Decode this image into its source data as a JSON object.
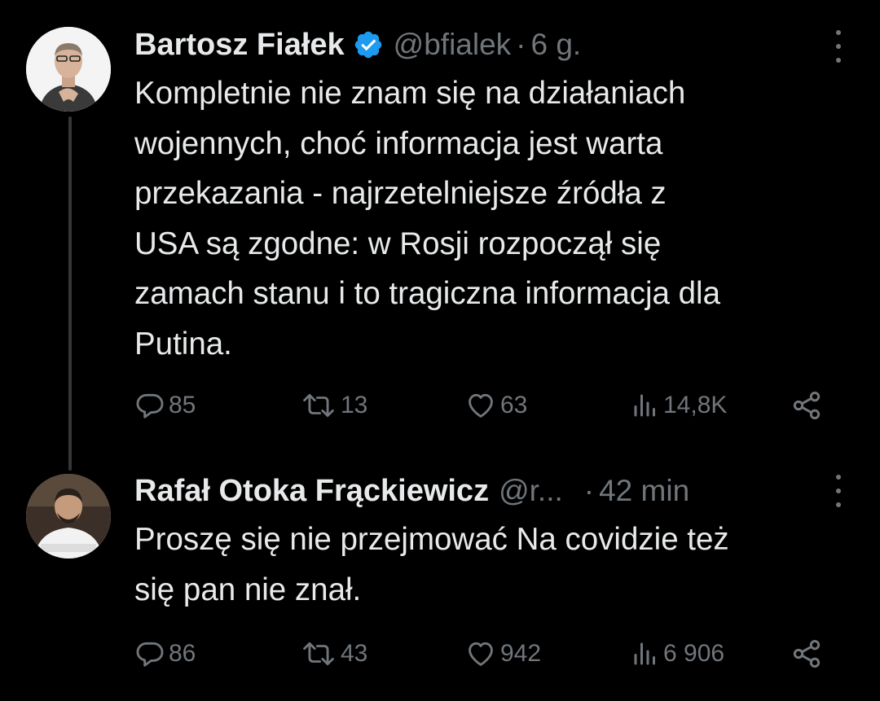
{
  "tweets": [
    {
      "author_name": "Bartosz Fiałek",
      "verified": true,
      "handle": "@bfialek",
      "separator": "·",
      "time": "6 g.",
      "text": "Kompletnie nie znam się na działaniach\nwojennych, choć informacja jest warta\nprzekazania - najrzetelniejsze źródła z\nUSA są zgodne: w Rosji rozpoczął się\nzamach stanu i to tragiczna informacja dla\nPutina.",
      "stats": {
        "replies": "85",
        "reposts": "13",
        "likes": "63",
        "views": "14,8K"
      }
    },
    {
      "author_name": "Rafał Otoka Frąckiewicz",
      "verified": false,
      "handle": "@r...",
      "separator": "·",
      "time": "42 min",
      "text": "Proszę się nie przejmować  Na covidzie też\nsię pan nie znał.",
      "stats": {
        "replies": "86",
        "reposts": "43",
        "likes": "942",
        "views": "6 906"
      }
    }
  ],
  "icons": {
    "reply": "reply-bubble-icon",
    "repost": "repost-arrows-icon",
    "like": "heart-icon",
    "views": "views-bar-chart-icon",
    "share": "share-icon",
    "verified": "verified-badge-icon",
    "more": "more-vertical-dots-icon"
  },
  "colors": {
    "background": "#000000",
    "text_primary": "#e7e9ea",
    "text_secondary": "#71767b",
    "verified_blue": "#1d9bf0",
    "thread_line": "#333639"
  }
}
